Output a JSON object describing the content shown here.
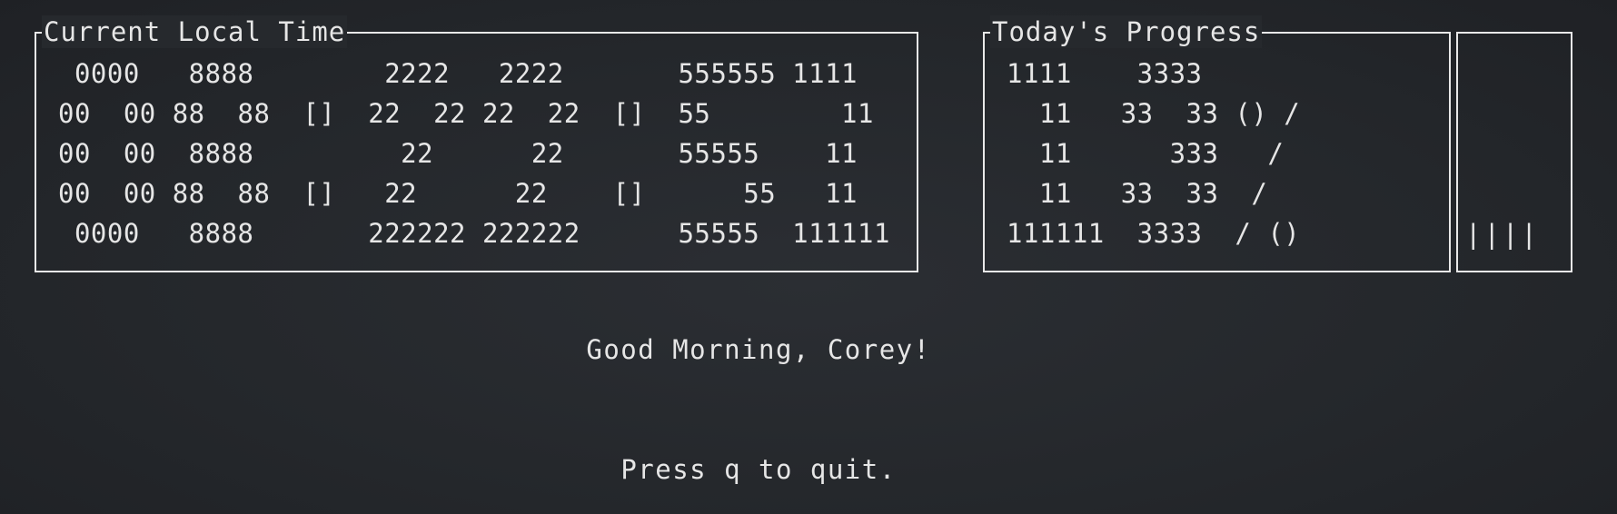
{
  "time_panel": {
    "title": "Current Local Time",
    "ascii_lines": [
      " 0000   8888        2222   2222       555555 1111",
      "00  00 88  88  []  22  22 22  22  []  55        11",
      "00  00  8888         22      22       55555    11",
      "00  00 88  88  []   22      22    []      55   11",
      " 0000   8888       222222 222222      55555  111111"
    ]
  },
  "progress_panel": {
    "title": "Today's Progress",
    "ascii_lines": [
      "1111    3333",
      "  11   33  33 () /",
      "  11      333   /",
      "  11   33  33  /",
      "111111  3333  / ()"
    ]
  },
  "progress_bar": {
    "fill_text": "||||",
    "percent": 13
  },
  "greeting": "Good Morning, Corey!",
  "quit_hint": "Press q to quit."
}
